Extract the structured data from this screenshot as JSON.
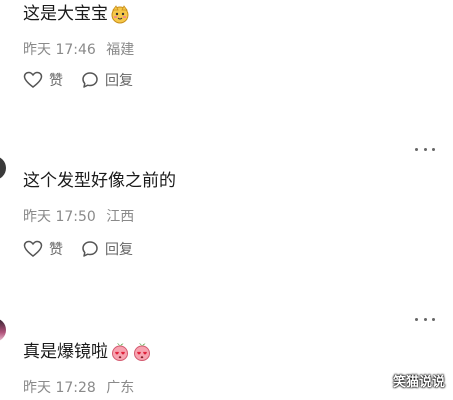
{
  "comments": [
    {
      "text": "这是大宝宝",
      "time": "昨天 17:46",
      "location": "福建",
      "like_label": "赞",
      "reply_label": "回复",
      "emojis": [
        "blushing-cat-emoji"
      ]
    },
    {
      "text": "这个发型好像之前的",
      "time": "昨天 17:50",
      "location": "江西",
      "like_label": "赞",
      "reply_label": "回复",
      "emojis": []
    },
    {
      "text": "真是爆镜啦",
      "time": "昨天 17:28",
      "location": "广东",
      "emojis": [
        "peach-heart-eyes-emoji",
        "peach-heart-eyes-emoji"
      ]
    }
  ],
  "watermark": "笑猫说说",
  "colors": {
    "meta_text": "#8a8a8a",
    "action_text": "#666666",
    "body_text": "#1a1a1a"
  }
}
